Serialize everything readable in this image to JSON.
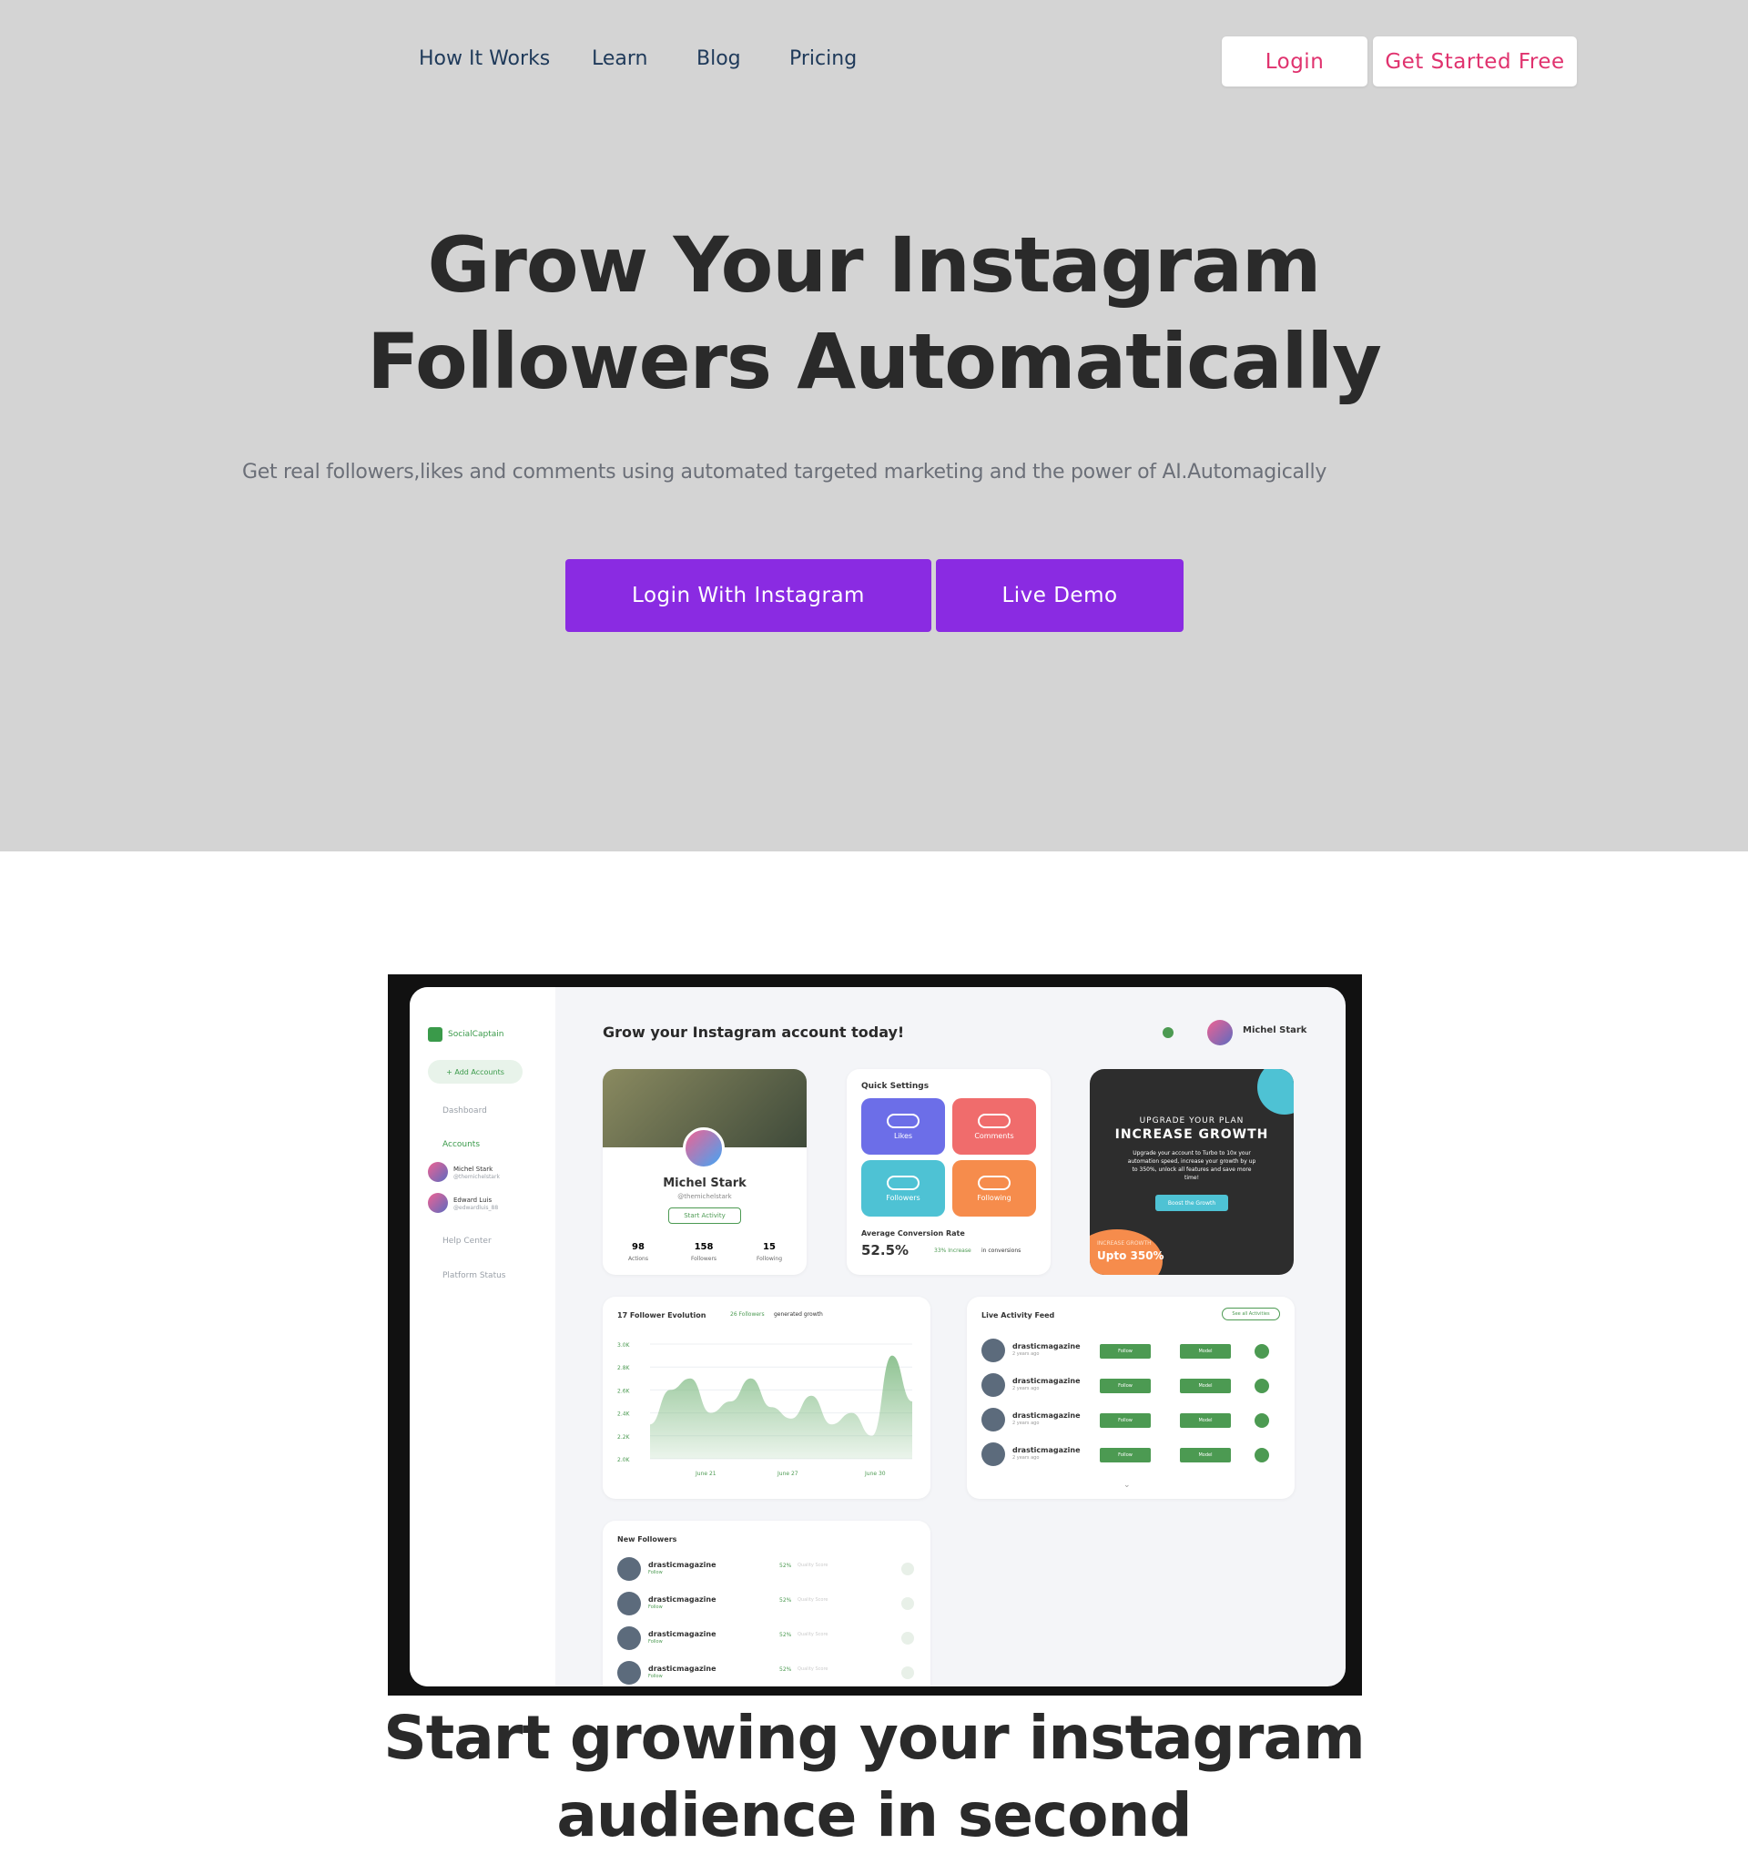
{
  "nav": {
    "links": [
      "How It Works",
      "Learn",
      "Blog",
      "Pricing"
    ],
    "login": "Login",
    "get_started": "Get Started Free"
  },
  "hero": {
    "title_line1": "Grow Your Instagram",
    "title_line2": "Followers Automatically",
    "subtitle": "Get real followers,likes and comments using automated targeted marketing and the power of AI.Automagically",
    "btn_login_instagram": "Login With Instagram",
    "btn_live_demo": "Live Demo"
  },
  "dashboard": {
    "brand": "SocialCaptain",
    "add_accounts": "+ Add Accounts",
    "sidebar": {
      "dashboard": "Dashboard",
      "accounts": "Accounts",
      "acc1": "Michel Stark",
      "acc1_handle": "@themichelstark",
      "acc2": "Edward Luis",
      "acc2_handle": "@edwardluis_88",
      "help": "Help Center",
      "status": "Platform Status"
    },
    "header_title": "Grow your Instagram account today!",
    "user": "Michel Stark",
    "profile": {
      "name": "Michel Stark",
      "handle": "@themichelstark",
      "start": "Start Activity",
      "stats": [
        {
          "value": "98",
          "label": "Actions"
        },
        {
          "value": "158",
          "label": "Followers"
        },
        {
          "value": "15",
          "label": "Following"
        }
      ]
    },
    "quick": {
      "title": "Quick Settings",
      "items": [
        "Likes",
        "Comments",
        "Followers",
        "Following"
      ],
      "conv_label": "Average Conversion Rate",
      "conv_value": "52.5%",
      "conv_note": "33% Increase",
      "conv_note2": "in conversions"
    },
    "promo": {
      "small": "UPGRADE YOUR PLAN",
      "big": "INCREASE GROWTH",
      "body": "Upgrade your account to Turbo to 10x your automation speed, increase your growth by up to 350%, unlock all features and save more time!",
      "cta": "Boost the Growth",
      "foot_small": "INCREASE GROWTH",
      "foot_big": "Upto 350%"
    },
    "evolution": {
      "title": "17 Follower Evolution",
      "badge": "26 Followers",
      "badge2": "generated growth"
    },
    "feed": {
      "title": "Live Activity Feed",
      "see_all": "See all Activities",
      "user": "drasticmagazine",
      "time": "2 years ago",
      "follow": "Follow",
      "model": "Model"
    },
    "new_followers": {
      "title": "New Followers",
      "user": "drasticmagazine",
      "action": "Follow",
      "score": "52%",
      "score_label": "Quality Score"
    }
  },
  "chart_data": {
    "type": "area",
    "title": "17 Follower Evolution",
    "x_labels": [
      "June 21",
      "June 27",
      "June 30"
    ],
    "y_ticks": [
      "3.0K",
      "2.8K",
      "2.6K",
      "2.4K",
      "2.2K",
      "2.0K"
    ],
    "series": [
      {
        "values": [
          2.3,
          2.6,
          2.7,
          2.4,
          2.5,
          2.7,
          2.45,
          2.35,
          2.55,
          2.3,
          2.4,
          2.2,
          2.9,
          2.5
        ]
      }
    ],
    "color": "#7bb87f"
  },
  "section2": {
    "title_line1": "Start growing your instagram",
    "title_line2": "audience in second"
  },
  "colors": {
    "hero_bg": "#d4d4d4",
    "purple": "#8a2be2",
    "pink": "#e0326e",
    "nav_text": "#1f3a5a"
  }
}
